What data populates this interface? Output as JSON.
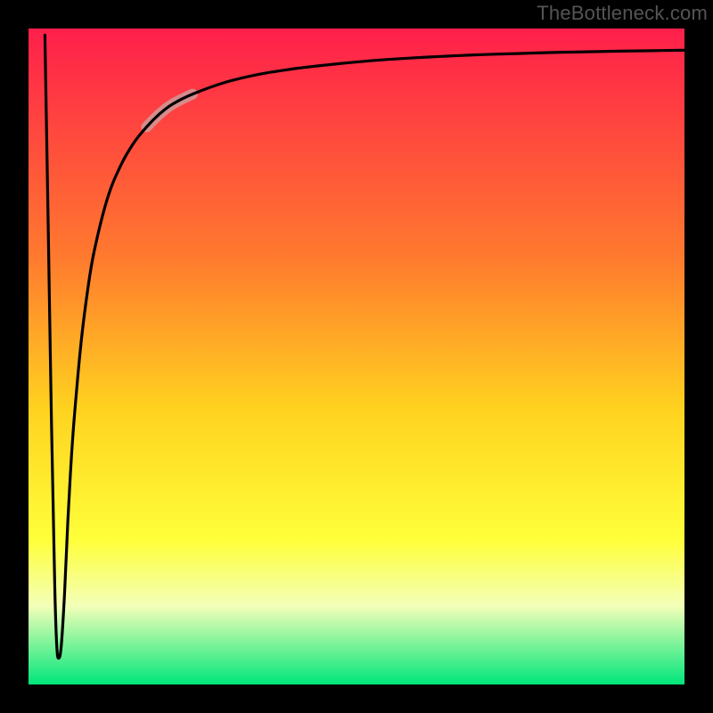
{
  "watermark": "TheBottleneck.com",
  "colors": {
    "background": "#000000",
    "gradient_top": "#ff1f4b",
    "gradient_mid_upper": "#ff7a2e",
    "gradient_mid": "#ffd21f",
    "gradient_mid_lower": "#ffff3a",
    "gradient_lower_soft": "#f3ffb8",
    "gradient_bottom": "#00e67a",
    "curve": "#000000",
    "highlight": "#caa5a5"
  },
  "chart_data": {
    "type": "line",
    "title": "",
    "xlabel": "",
    "ylabel": "",
    "xlim": [
      0,
      100
    ],
    "ylim": [
      0,
      100
    ],
    "series": [
      {
        "name": "bottleneck-curve",
        "x": [
          2.5,
          3.0,
          3.5,
          4.0,
          4.3,
          4.6,
          5.0,
          5.5,
          6.0,
          6.5,
          7.0,
          8.0,
          9.0,
          10.0,
          12.0,
          14.0,
          16.0,
          18.0,
          20.0,
          22.0,
          25.0,
          30.0,
          35.0,
          40.0,
          45.0,
          50.0,
          55.0,
          60.0,
          65.0,
          70.0,
          75.0,
          80.0,
          85.0,
          90.0,
          95.0,
          100.0
        ],
        "y": [
          99.0,
          70.0,
          40.0,
          15.0,
          6.0,
          4.0,
          6.0,
          14.0,
          25.0,
          34.0,
          41.0,
          52.0,
          60.0,
          66.0,
          74.0,
          79.0,
          82.5,
          85.0,
          87.0,
          88.5,
          90.0,
          91.8,
          93.0,
          93.8,
          94.4,
          94.9,
          95.3,
          95.6,
          95.85,
          96.05,
          96.2,
          96.35,
          96.45,
          96.55,
          96.62,
          96.7
        ]
      }
    ],
    "highlight_segment": {
      "series": "bottleneck-curve",
      "x_start": 18.0,
      "x_end": 25.0
    },
    "gradient_stops_y": [
      {
        "y": 100,
        "hint": "red-pink"
      },
      {
        "y": 70,
        "hint": "orange"
      },
      {
        "y": 45,
        "hint": "yellow"
      },
      {
        "y": 18,
        "hint": "pale-yellow"
      },
      {
        "y": 5,
        "hint": "green"
      }
    ]
  }
}
